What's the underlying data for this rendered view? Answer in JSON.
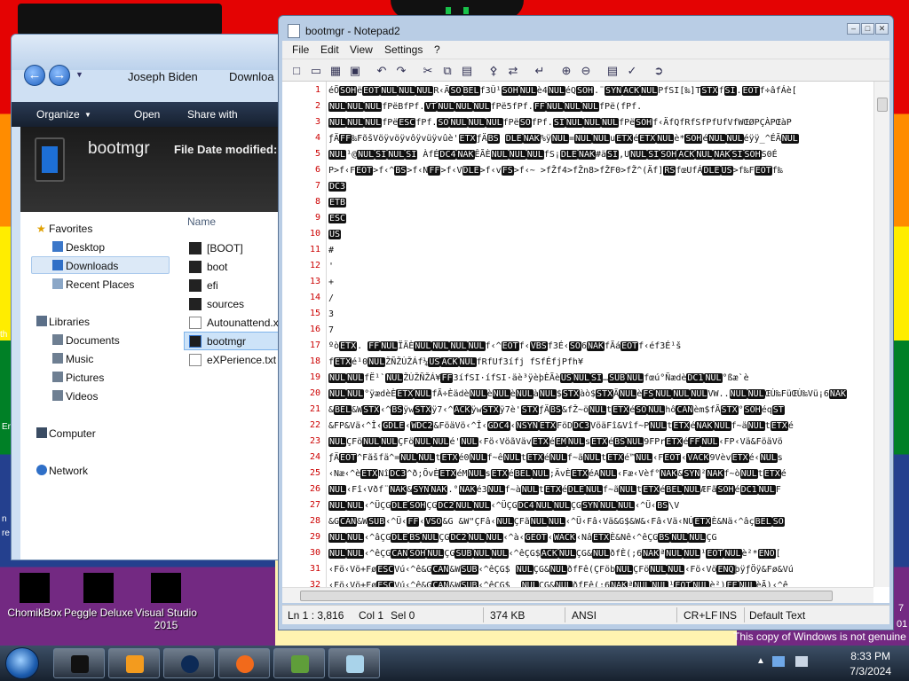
{
  "desktop": {
    "icons": [
      {
        "label": "ChomikBox"
      },
      {
        "label": "Peggle Deluxe"
      },
      {
        "label": "Visual Studio 2015"
      }
    ],
    "edge_texts": [
      "th",
      "En",
      "n",
      "re"
    ],
    "genuine_notice": "This copy of Windows is not genuine"
  },
  "explorer": {
    "breadcrumb": [
      "Joseph Biden",
      "Downloa"
    ],
    "toolbar": {
      "organize": "Organize",
      "open": "Open",
      "share_with": "Share with"
    },
    "details": {
      "file_name": "bootmgr",
      "label": "File  Date modified:"
    },
    "nav": {
      "favorites": "Favorites",
      "desktop": "Desktop",
      "downloads": "Downloads",
      "recent": "Recent Places",
      "libraries": "Libraries",
      "documents": "Documents",
      "music": "Music",
      "pictures": "Pictures",
      "videos": "Videos",
      "computer": "Computer",
      "network": "Network"
    },
    "column_name": "Name",
    "files": [
      "[BOOT]",
      "boot",
      "efi",
      "sources",
      "Autounattend.xm",
      "bootmgr",
      "eXPerience.txt"
    ]
  },
  "notepad": {
    "title": "bootmgr - Notepad2",
    "menu": [
      "File",
      "Edit",
      "View",
      "Settings",
      "?"
    ],
    "lines": [
      {
        "n": "1",
        "t": "éÕ[SOH]ë[EOT][NUL][NUL][NUL]R‹Ä[SO][BEL]f3Û¹[SOH][NUL]è4[NUL]éQ[SOH].¨[SYN][ACK][NUL]PfSI[‰]T[STX]f[SI].[EOT]f÷âfÁè["
      },
      {
        "n": "2",
        "t": "[NUL][NUL][NUL]fPëBfPf.[VT][NUL][NUL][NUL]fPë5fPf.[FF][NUL][NUL][NUL]fPë(fPf."
      },
      {
        "n": "3",
        "t": "[NUL][NUL][NUL]fPë[ESC]fPf.[SO][NUL][NUL][NUL]fPë[SO]fPf.[SI][NUL][NUL][NUL]fPë[SOH]f‹ÄfQfRfSfPfUfVfWŒØPÇÀPŒàP"
      },
      {
        "n": "4",
        "t": "ƒÄ[FF]‰FõšVöÿvöÿvôÿvüÿvûè'[ETX]ƒÄ[BS] [DLE][NAK]%ÿ[NUL]=[NUL][NUL]u[ETX]é[ETX][NUL]è*[SOH]é[NUL][NUL]éÿÿ_^ÉÃ[NUL]"
      },
      {
        "n": "5",
        "t": "[NUL]¹@[NUL][SI][NUL][SI] ÀfÉ[DC4][NAK]ÊÃÈ[NUL][NUL][NUL]fS¡[DLE][NAK]#ä[SI],U[NUL][SI][SOH][ACK][NUL][NAK][SI][SOH]S0É"
      },
      {
        "n": "6",
        "t": "P>f‹F[EOT]>f‹^[BS]>f‹N[FF]>f‹V[DLE]>f‹v[FS]>f‹~ >fŽf4>fŽn8>fŽF0>fŽ^(Äf][RS]fœUfÁ[DLE][US]>f‰F[EOT]f‰"
      },
      {
        "n": "7",
        "t": "[DC3]"
      },
      {
        "n": "8",
        "t": "[ETB]"
      },
      {
        "n": "9",
        "t": "[ESC]"
      },
      {
        "n": "10",
        "t": "[US]"
      },
      {
        "n": "11",
        "t": "#"
      },
      {
        "n": "12",
        "t": "'"
      },
      {
        "n": "13",
        "t": "+"
      },
      {
        "n": "14",
        "t": "/"
      },
      {
        "n": "15",
        "t": "3"
      },
      {
        "n": "16",
        "t": "7"
      },
      {
        "n": "17",
        "t": "ºò[ETX]. [FF][NUL]ÏÄÈ[NUL][NUL][NUL][NUL]f‹^[EOT]f‹[VBS]f3É‹[SO]6[NAK]fÃá[EOT]f‹éf3É¹š"
      },
      {
        "n": "18",
        "t": "f[ETX]é¹0[NUL]ŽÑŽÙŽÁf¼[US][ACK][NUL]fRfUf3ífj fSfÉfjPfh¥"
      },
      {
        "n": "19",
        "t": "[NUL][NUL]fË¹`[NUL]ŽÙŽÑŽÁ¥[FF]3ífSI·ífSI·äè³ÿèþÈÃè[US][NUL][SI]…[SUB][NUL]fœú°Ñædè[DC1][NUL]°ßæ`è"
      },
      {
        "n": "20",
        "t": "[NUL][NUL]°ÿædèÈ[ETX][NUL]fÃ÷Èädè[NUL]è[NUL]è[NUL]à[NUL]$[STX]àò$[STX]Ã[NUL]è[FS][NUL][NUL][NUL]VW..[NUL][NUL]ŒÙ‰FüŒÙ‰Vü¡6[NAK]"
      },
      {
        "n": "21",
        "t": "&[BEL]&W[STX]‹^[BS]ÿw[STX]ÿ7‹^[ACK]ÿw[STX]ÿ7è'[STX]ƒÄ[BS]&fŽ~ö[NUL]t[ETX]é[SO][NUL]hô[CAN]èm$fÃ[STX]°[SOH]éq[ST]"
      },
      {
        "n": "22",
        "t": "&FP&Vä‹^Î‹[GDLE]‹[WDC2]&FöäVö‹^Î‹[GDC4]‹[NSYN][ETX]FöD[DC3]VöäFî&Vîf~P[NUL]t[ETX]é[NAK][NUL]f~ä[NUL]t[ETX]é"
      },
      {
        "n": "23",
        "t": "[NUL]ÇFö[NUL][NUL]ÇFö[NUL][NUL]é'[NUL]‹Fö‹VöãVäv[ETX]é[EM][NUL]s[ETX]é[BS][NUL]9FPr[ETX]é[FF][NUL]‹FP‹Vä&FöäVö"
      },
      {
        "n": "24",
        "t": "ƒÄ[EOT]^Fãšfä^=[NUL][NUL]t[ETX]é0[NUL]f~ê[NUL]t[ETX]é[NUL]f~ã[NUL]t[ETX]é™[NUL]‹F[EOT]‹[VACK]9Vèv[ETX]é‹[NUL]s"
      },
      {
        "n": "25",
        "t": "‹Næ‹^è[ETX]Nî[DC3]^ð;ÕvÈ[ETX]éM[NUL]s[ETX]é[BEL][NUL];ÄvÈ[ETX]éA[NUL]‹Fæ‹Vèf°[NAK]&[SYN]²[NAK]f~ò[NUL]t[ETX]é"
      },
      {
        "n": "26",
        "t": "[NUL]‹Fî‹Vðf¨[NAK]&[SYN][NAK].°[NAK]é3[NUL]f~à[NUL]t[ETX]é[DLE][NUL]f~ã[NUL]t[ETX]é[BEL][NUL]ÆFã[SOH]é[DC1][NUL]F"
      },
      {
        "n": "27",
        "t": "[NUL][NUL]‹^ÜÇG[DLE][SOH]ÇG[DC2][NUL][NUL]‹^ÜÇG[DC4][NUL][NUL]ÇG[SYN][NUL][NUL]‹^Ü‹[BS]\\V"
      },
      {
        "n": "28",
        "t": "&G[CAN]&W[SUB]‹^Ü‹[FF]‹[VSO]&G &W\"ÇFâ‹[NUL]ÇFã[NUL][NUL]‹^Ü‹Fâ‹Vä&G$&W&‹Fâ‹Vä‹NÚ[ETX]È&Nä‹^âç[BEL][SO]"
      },
      {
        "n": "29",
        "t": "[NUL][NUL]‹^âÇG[DLE][BS][NUL]ÇG[DC2][NUL][NUL]‹^à‹[GEOT]‹[WACK]‹Nâ[ETX]È&Nê‹^êÇG[BS][NUL][NUL]ÇG"
      },
      {
        "n": "30",
        "t": "[NUL][NUL]‹^êÇG[CAN][SOH][NUL]ÇG[SUB][NUL][NUL]‹^êÇG$[ACK][NUL]ÇG&[NUL]ðfÈ(;6[NAK]ª[NUL][NUL]¹[EOT][NUL]è²*[ENO]["
      },
      {
        "n": "31",
        "t": "‹Fö‹Vö+Fø[ESC]Vú‹^ê&G[CAN]&W[SUB]‹^êÇG$ [NUL]ÇG&[NUL]ðfFê(ÇFöb[NUL]ÇFö[NUL][NUL]‹Fö‹Vö[ENQ]þÿƒÖÿ&Fø&Vú"
      },
      {
        "n": "32",
        "t": "‹Fö‹Vö+Fø[ESC]Vú‹^ê&G[CAN]&W[SUB]‹^êÇG$  [NUL]ÇG&[NUL]ðfFê(;6[NAK]ª[NUL][NUL]¹[EOT][NUL]è²)[FF][NUL]èÃ)‹^ê"
      }
    ],
    "status": {
      "ln": "Ln 1 : 3,816",
      "col": "Col 1",
      "sel": "Sel 0",
      "size": "374 KB",
      "encoding": "ANSI",
      "eol": "CR+LF",
      "ins": "INS",
      "scheme": "Default Text"
    }
  },
  "taskbar": {
    "time": "8:33 PM",
    "date": "7/3/2024",
    "peek_7": "7",
    "peek_01": "01"
  }
}
